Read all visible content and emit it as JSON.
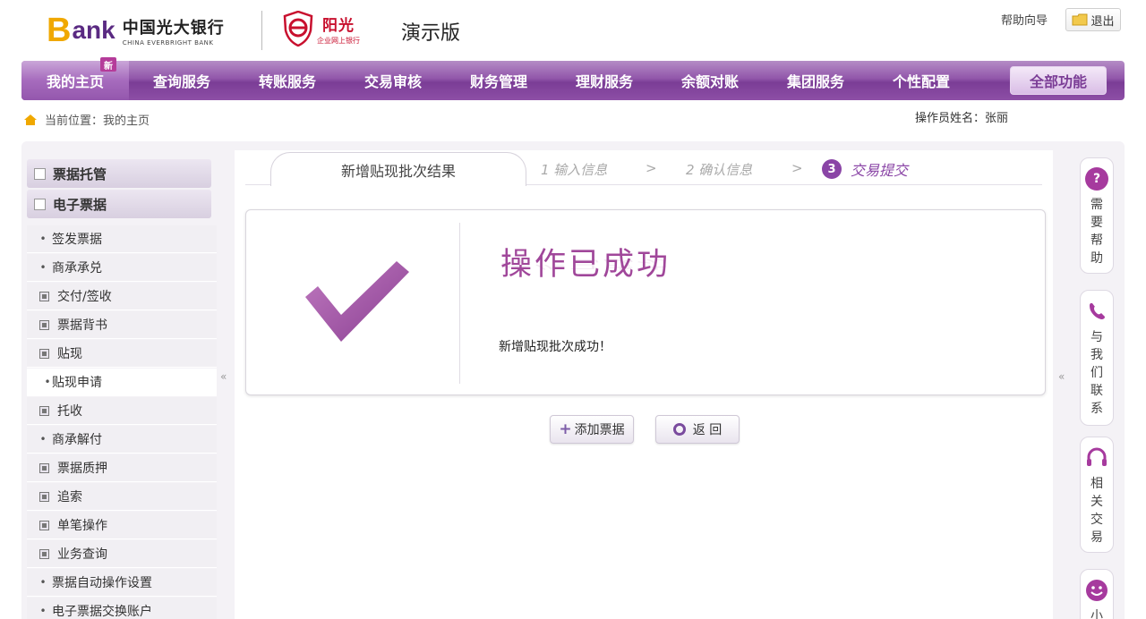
{
  "header": {
    "logo_b": "B",
    "logo_ank": "ank",
    "logo_cn": "中国光大银行",
    "logo_en": "CHINA EVERBRIGHT BANK",
    "sub_logo_cn": "阳光",
    "sub_logo_sub": "企业网上银行",
    "demo_label": "演示版",
    "guide_link": "帮助向导",
    "exit_label": "退出"
  },
  "nav": {
    "items": [
      {
        "label": "我的主页",
        "active": true,
        "badge": "新"
      },
      {
        "label": "查询服务"
      },
      {
        "label": "转账服务"
      },
      {
        "label": "交易审核"
      },
      {
        "label": "财务管理"
      },
      {
        "label": "理财服务"
      },
      {
        "label": "余额对账"
      },
      {
        "label": "集团服务"
      },
      {
        "label": "个性配置"
      }
    ],
    "all_functions": "全部功能"
  },
  "breadcrumb": {
    "text": "当前位置：我的主页"
  },
  "operator": "操作员姓名：张丽",
  "sidebar": {
    "categories": [
      {
        "label": "票据托管"
      },
      {
        "label": "电子票据"
      }
    ],
    "items": [
      {
        "label": "签发票据",
        "type": "bullet"
      },
      {
        "label": "商承承兑",
        "type": "bullet"
      },
      {
        "label": "交付/签收",
        "type": "box"
      },
      {
        "label": "票据背书",
        "type": "box"
      },
      {
        "label": "贴现",
        "type": "box"
      },
      {
        "label": "贴现申请",
        "type": "bullet",
        "selected": true
      },
      {
        "label": "托收",
        "type": "box"
      },
      {
        "label": "商承解付",
        "type": "bullet"
      },
      {
        "label": "票据质押",
        "type": "box"
      },
      {
        "label": "追索",
        "type": "box"
      },
      {
        "label": "单笔操作",
        "type": "box"
      },
      {
        "label": "业务查询",
        "type": "box"
      },
      {
        "label": "票据自动操作设置",
        "type": "bullet"
      },
      {
        "label": "电子票据交换账户",
        "type": "bullet"
      }
    ],
    "collapse": "«"
  },
  "main": {
    "tab_title": "新增贴现批次结果",
    "steps": [
      {
        "label": "1  输入信息"
      },
      {
        "label": "2  确认信息"
      },
      {
        "num": "3",
        "label": "交易提交",
        "active": true
      }
    ],
    "step_arrow": ">",
    "success_title": "操作已成功",
    "success_msg": "新增贴现批次成功！",
    "buttons": {
      "add": "添加票据",
      "back": "返 回"
    },
    "collapse_right": "«"
  },
  "right_panel": [
    {
      "icon": "?",
      "text": "需要帮助"
    },
    {
      "icon": "phone",
      "text": "与我们联系"
    },
    {
      "icon": "headset",
      "text": "相关交易"
    },
    {
      "icon": "smile",
      "text": "小"
    }
  ],
  "colors": {
    "brand_purple": "#7b3d96",
    "accent_purple": "#a0479a",
    "logo_yellow": "#f0a800",
    "sub_logo_red": "#c8102e"
  }
}
